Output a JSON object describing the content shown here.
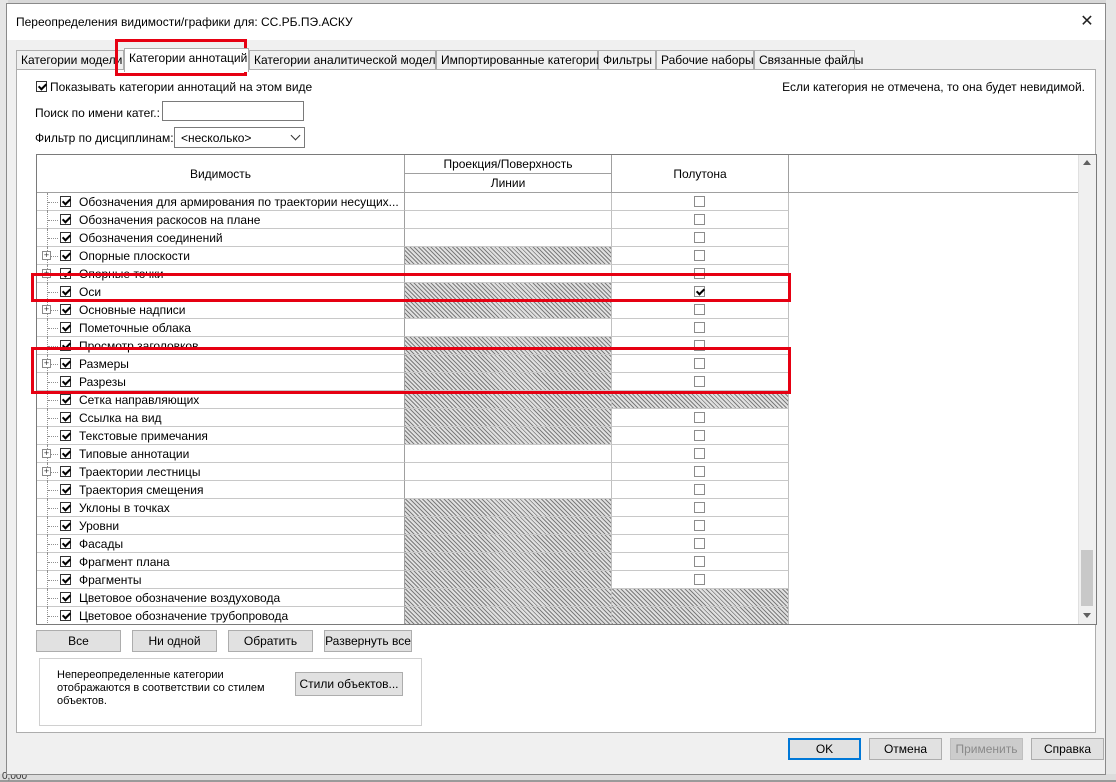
{
  "dialog": {
    "title": "Переопределения видимости/графики для: СС.РБ.ПЭ.АСКУ",
    "close_glyph": "✕"
  },
  "tabs": [
    {
      "label": "Категории модели",
      "active": false
    },
    {
      "label": "Категории аннотаций",
      "active": true
    },
    {
      "label": "Категории аналитической модели",
      "active": false
    },
    {
      "label": "Импортированные категории",
      "active": false
    },
    {
      "label": "Фильтры",
      "active": false
    },
    {
      "label": "Рабочие наборы",
      "active": false
    },
    {
      "label": "Связанные файлы",
      "active": false
    }
  ],
  "panel": {
    "show_checkbox_label": "Показывать категории аннотаций на этом виде",
    "show_checkbox_checked": true,
    "info_text": "Если категория не отмечена, то она будет невидимой.",
    "search_label": "Поиск по имени катег.:",
    "search_value": "",
    "filter_label": "Фильтр по дисциплинам:",
    "filter_value": "<несколько>"
  },
  "grid": {
    "headers": {
      "visibility": "Видимость",
      "projection": "Проекция/Поверхность",
      "lines": "Линии",
      "halftone": "Полутона"
    },
    "rows": [
      {
        "name": "Обозначения для армирования по траектории несущих...",
        "expandable": false,
        "visible": true,
        "proj_hatched": false,
        "halftone": "unchecked"
      },
      {
        "name": "Обозначения раскосов на плане",
        "expandable": false,
        "visible": true,
        "proj_hatched": false,
        "halftone": "unchecked"
      },
      {
        "name": "Обозначения соединений",
        "expandable": false,
        "visible": true,
        "proj_hatched": false,
        "halftone": "unchecked"
      },
      {
        "name": "Опорные плоскости",
        "expandable": true,
        "visible": true,
        "proj_hatched": true,
        "halftone": "unchecked"
      },
      {
        "name": "Опорные точки",
        "expandable": true,
        "visible": true,
        "proj_hatched": false,
        "halftone": "unchecked"
      },
      {
        "name": "Оси",
        "expandable": false,
        "visible": true,
        "proj_hatched": true,
        "halftone": "checked"
      },
      {
        "name": "Основные надписи",
        "expandable": true,
        "visible": true,
        "proj_hatched": true,
        "halftone": "unchecked"
      },
      {
        "name": "Пометочные облака",
        "expandable": false,
        "visible": true,
        "proj_hatched": false,
        "halftone": "unchecked"
      },
      {
        "name": "Просмотр заголовков",
        "expandable": false,
        "visible": true,
        "proj_hatched": true,
        "halftone": "unchecked"
      },
      {
        "name": "Размеры",
        "expandable": true,
        "visible": true,
        "proj_hatched": true,
        "halftone": "unchecked"
      },
      {
        "name": "Разрезы",
        "expandable": false,
        "visible": true,
        "proj_hatched": true,
        "halftone": "unchecked"
      },
      {
        "name": "Сетка направляющих",
        "expandable": false,
        "visible": true,
        "proj_hatched": true,
        "halftone": "hatched"
      },
      {
        "name": "Ссылка на вид",
        "expandable": false,
        "visible": true,
        "proj_hatched": true,
        "halftone": "unchecked"
      },
      {
        "name": "Текстовые примечания",
        "expandable": false,
        "visible": true,
        "proj_hatched": true,
        "halftone": "unchecked"
      },
      {
        "name": "Типовые аннотации",
        "expandable": true,
        "visible": true,
        "proj_hatched": false,
        "halftone": "unchecked"
      },
      {
        "name": "Траектории лестницы",
        "expandable": true,
        "visible": true,
        "proj_hatched": false,
        "halftone": "unchecked"
      },
      {
        "name": "Траектория смещения",
        "expandable": false,
        "visible": true,
        "proj_hatched": false,
        "halftone": "unchecked"
      },
      {
        "name": "Уклоны в точках",
        "expandable": false,
        "visible": true,
        "proj_hatched": true,
        "halftone": "unchecked"
      },
      {
        "name": "Уровни",
        "expandable": false,
        "visible": true,
        "proj_hatched": true,
        "halftone": "unchecked"
      },
      {
        "name": "Фасады",
        "expandable": false,
        "visible": true,
        "proj_hatched": true,
        "halftone": "unchecked"
      },
      {
        "name": "Фрагмент плана",
        "expandable": false,
        "visible": true,
        "proj_hatched": true,
        "halftone": "unchecked"
      },
      {
        "name": "Фрагменты",
        "expandable": false,
        "visible": true,
        "proj_hatched": true,
        "halftone": "unchecked"
      },
      {
        "name": "Цветовое обозначение воздуховода",
        "expandable": false,
        "visible": true,
        "proj_hatched": true,
        "halftone": "hatched"
      },
      {
        "name": "Цветовое обозначение трубопровода",
        "expandable": false,
        "visible": true,
        "proj_hatched": true,
        "halftone": "hatched"
      }
    ]
  },
  "grid_buttons": {
    "all": "Все",
    "none": "Ни одной",
    "invert": "Обратить",
    "expand_all": "Развернуть все"
  },
  "note": {
    "text": "Непереопределенные категории отображаются в соответствии со стилем объектов.",
    "object_styles_button": "Стили объектов..."
  },
  "footer": {
    "ok": "OK",
    "cancel": "Отмена",
    "apply": "Применить",
    "help": "Справка"
  },
  "background": {
    "bottom_text": "0,000"
  },
  "colors": {
    "highlight": "#e60012",
    "primary_border": "#0078d7"
  }
}
